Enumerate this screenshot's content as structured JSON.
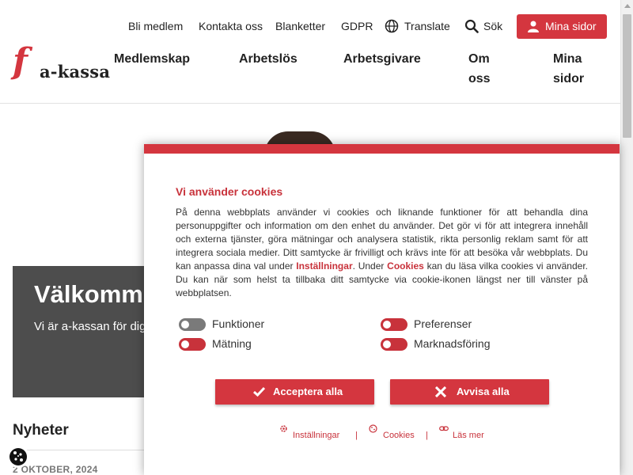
{
  "brand": {
    "logo_letter": "f",
    "logo_text": "a-kassa",
    "accent": "#d4363f"
  },
  "topnav": {
    "bli_medlem": "Bli medlem",
    "kontakta": "Kontakta oss",
    "blanketter": "Blanketter",
    "gdpr": "GDPR",
    "translate": "Translate",
    "sok": "Sök",
    "mina_sidor_button": "Mina sidor"
  },
  "mainnav": {
    "medlemskap": "Medlemskap",
    "arbetslos": "Arbetslös",
    "arbetsgivare": "Arbetsgivare",
    "om_line1": "Om",
    "om_line2": "oss",
    "mina_line1": "Mina",
    "mina_line2": "sidor"
  },
  "hero": {
    "title": "Välkomme",
    "text": "Vi är a-kassan för dig fönsterputsare. Ans hemsidan."
  },
  "news": {
    "title": "Nyheter",
    "date": "2 OKTOBER, 2024"
  },
  "cookie": {
    "title": "Vi använder cookies",
    "text_part1": "På denna webbplats använder vi cookies och liknande funktioner för att behandla dina personuppgifter och information om den enhet du använder. Det gör vi för att integrera innehåll och externa tjänster, göra mätningar och analysera statistik, rikta personlig reklam samt för att integrera sociala medier. Ditt samtycke är frivilligt och krävs inte för att besöka vår webbplats. Du kan anpassa dina val under ",
    "link_installningar": "Inställningar",
    "text_part2": ". Under ",
    "link_cookies": "Cookies",
    "text_part3": " kan du läsa vilka cookies vi använder. Du kan när som helst ta tillbaka ditt samtycke via cookie-ikonen längst ner till vänster på webbplatsen.",
    "toggles": {
      "funktioner": "Funktioner",
      "preferenser": "Preferenser",
      "matning": "Mätning",
      "marknadsforing": "Marknadsföring"
    },
    "accept_button": "Acceptera alla",
    "reject_button": "Avvisa alla",
    "footer": {
      "installningar": "Inställningar",
      "cookies": "Cookies",
      "las_mer": "Läs mer",
      "separator": "|"
    }
  }
}
